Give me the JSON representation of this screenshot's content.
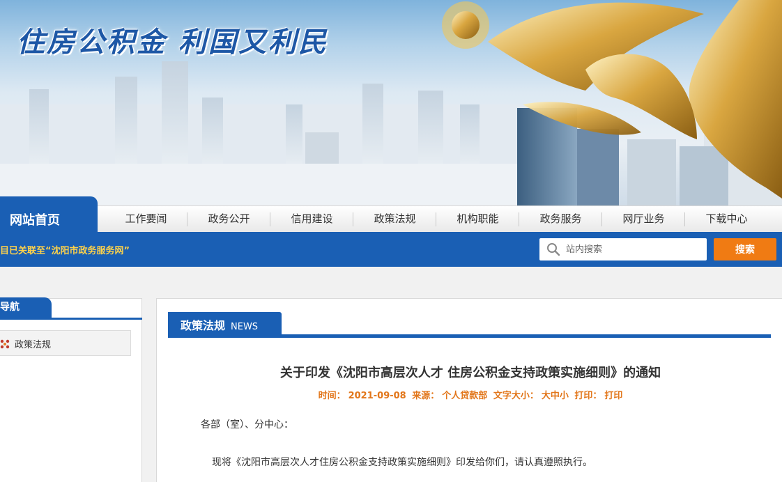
{
  "banner": {
    "slogan": "住房公积金  利国又利民"
  },
  "nav": {
    "home": "网站首页",
    "items": [
      "工作要闻",
      "政务公开",
      "信用建设",
      "政策法规",
      "机构职能",
      "政务服务",
      "网厅业务",
      "下载中心"
    ]
  },
  "notice": "目已关联至“沈阳市政务服务网”",
  "search": {
    "placeholder": "站内搜索",
    "button_label": "搜索"
  },
  "sidebar": {
    "title": "站导航",
    "items": [
      {
        "label": "政策法规",
        "icon": "flower-bullet-icon"
      }
    ]
  },
  "section": {
    "title": "政策法规",
    "en": "NEWS"
  },
  "article": {
    "title": "关于印发《沈阳市高层次人才 住房公积金支持政策实施细则》的通知",
    "meta": {
      "time_label": "时间：",
      "time": "2021-09-08",
      "source_label": "来源：",
      "source": "个人贷款部",
      "fontsize_label": "文字大小：",
      "fontsize_options": "大中小",
      "print_label": "打印：",
      "print": "打印"
    },
    "salutation": "各部（室）、分中心：",
    "paragraph": "现将《沈阳市高层次人才住房公积金支持政策实施细则》印发给你们，请认真遵照执行。"
  },
  "colors": {
    "brand_blue": "#1a5fb4",
    "search_orange": "#f07b13",
    "meta_orange": "#e2761a",
    "notice_yellow": "#ffd24a"
  }
}
